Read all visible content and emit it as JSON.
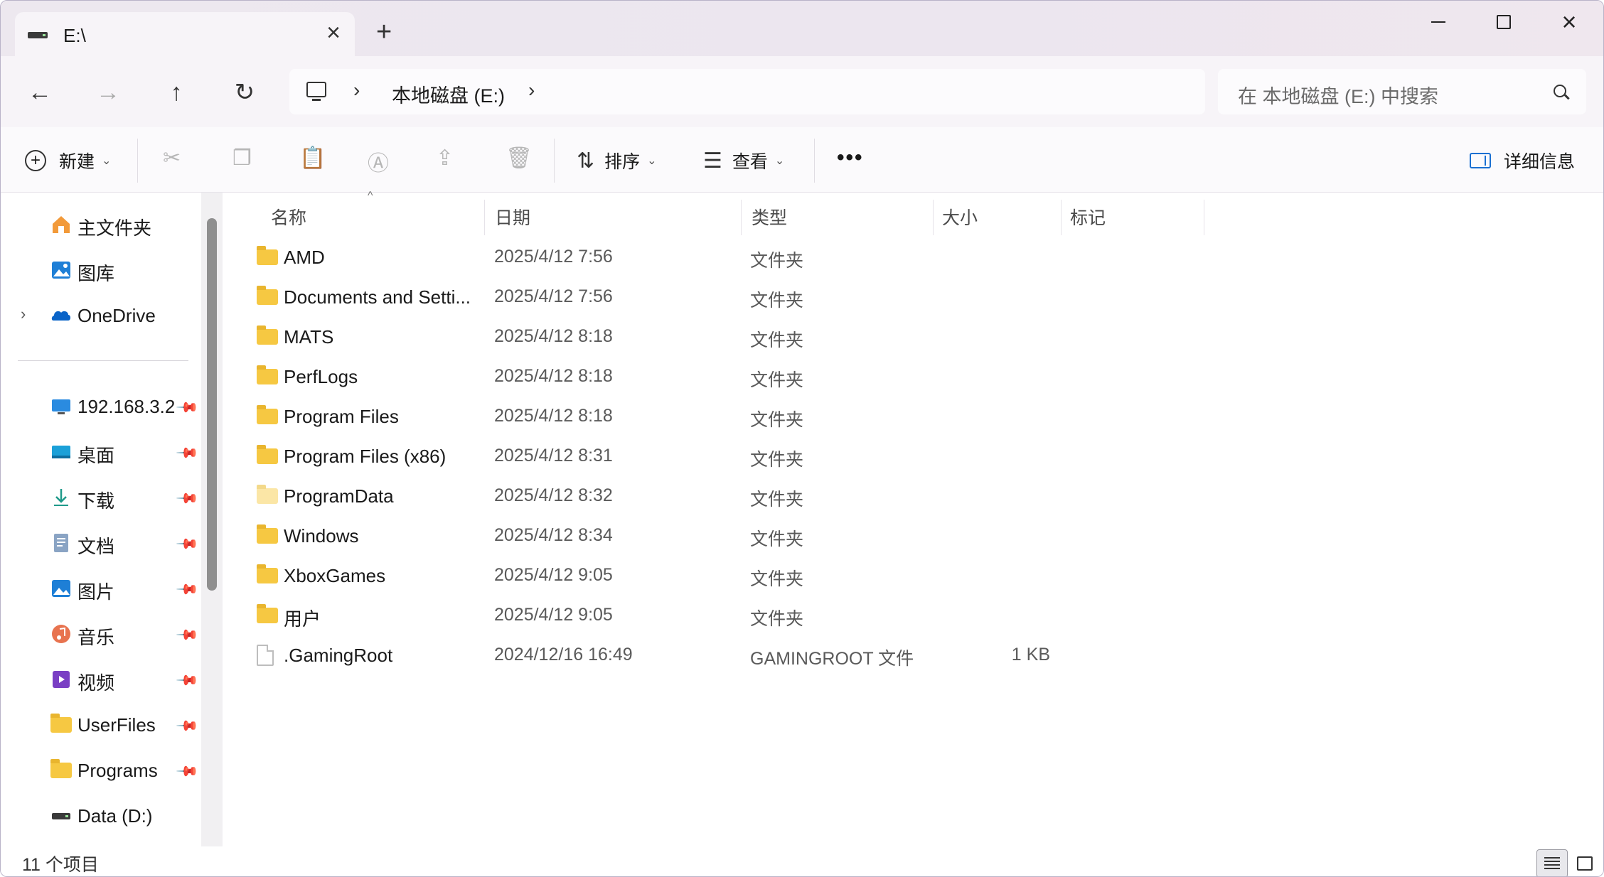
{
  "window": {
    "tab_title": "E:\\",
    "new_tab_symbol": "+",
    "close_tab_symbol": "×",
    "minimize_symbol": "—",
    "maximize_symbol": "□",
    "close_symbol": "×"
  },
  "nav": {
    "back_symbol": "←",
    "forward_symbol": "→",
    "up_symbol": "↑",
    "refresh_symbol": "↻",
    "breadcrumb": "本地磁盘 (E:)",
    "breadcrumb_sep": "›",
    "search_placeholder": "在 本地磁盘 (E:) 中搜索"
  },
  "toolbar": {
    "new_label": "新建",
    "sort_label": "排序",
    "view_label": "查看",
    "more_label": "•••",
    "details_label": "详细信息",
    "dim_icons": [
      "cut-icon",
      "copy-icon",
      "paste-icon",
      "rename-icon",
      "share-icon",
      "delete-icon"
    ]
  },
  "sidebar": {
    "top_items": [
      {
        "label": "主文件夹",
        "icon": "home-icon"
      },
      {
        "label": "图库",
        "icon": "gallery-icon"
      },
      {
        "label": "OneDrive",
        "icon": "onedrive-icon"
      }
    ],
    "pinned_items": [
      {
        "label": "192.168.3.2",
        "icon": "network-pc-icon"
      },
      {
        "label": "桌面",
        "icon": "desktop-icon"
      },
      {
        "label": "下载",
        "icon": "download-icon"
      },
      {
        "label": "文档",
        "icon": "documents-icon"
      },
      {
        "label": "图片",
        "icon": "pictures-icon"
      },
      {
        "label": "音乐",
        "icon": "music-icon"
      },
      {
        "label": "视频",
        "icon": "videos-icon"
      },
      {
        "label": "UserFiles",
        "icon": "folder-icon"
      },
      {
        "label": "Programs",
        "icon": "folder-icon"
      },
      {
        "label": "Data (D:)",
        "icon": "drive-icon"
      }
    ],
    "pin_symbol": "📌"
  },
  "columns": {
    "name": "名称",
    "date": "日期",
    "type": "类型",
    "size": "大小",
    "tags": "标记",
    "sort_caret": "^"
  },
  "files": [
    {
      "name": "AMD",
      "date": "2025/4/12 7:56",
      "type": "文件夹",
      "size": "",
      "icon": "folder"
    },
    {
      "name": "Documents and Setti...",
      "date": "2025/4/12 7:56",
      "type": "文件夹",
      "size": "",
      "icon": "folder"
    },
    {
      "name": "MATS",
      "date": "2025/4/12 8:18",
      "type": "文件夹",
      "size": "",
      "icon": "folder"
    },
    {
      "name": "PerfLogs",
      "date": "2025/4/12 8:18",
      "type": "文件夹",
      "size": "",
      "icon": "folder"
    },
    {
      "name": "Program Files",
      "date": "2025/4/12 8:18",
      "type": "文件夹",
      "size": "",
      "icon": "folder"
    },
    {
      "name": "Program Files (x86)",
      "date": "2025/4/12 8:31",
      "type": "文件夹",
      "size": "",
      "icon": "folder"
    },
    {
      "name": "ProgramData",
      "date": "2025/4/12 8:32",
      "type": "文件夹",
      "size": "",
      "icon": "folder-hidden"
    },
    {
      "name": "Windows",
      "date": "2025/4/12 8:34",
      "type": "文件夹",
      "size": "",
      "icon": "folder"
    },
    {
      "name": "XboxGames",
      "date": "2025/4/12 9:05",
      "type": "文件夹",
      "size": "",
      "icon": "folder"
    },
    {
      "name": "用户",
      "date": "2025/4/12 9:05",
      "type": "文件夹",
      "size": "",
      "icon": "folder"
    },
    {
      "name": ".GamingRoot",
      "date": "2024/12/16 16:49",
      "type": "GAMINGROOT 文件",
      "size": "1 KB",
      "icon": "file"
    }
  ],
  "status": {
    "item_count": "11 个项目"
  },
  "colors": {
    "accent": "#1a6fd1",
    "folder": "#f6c842",
    "titlebar": "#ede8ef"
  }
}
